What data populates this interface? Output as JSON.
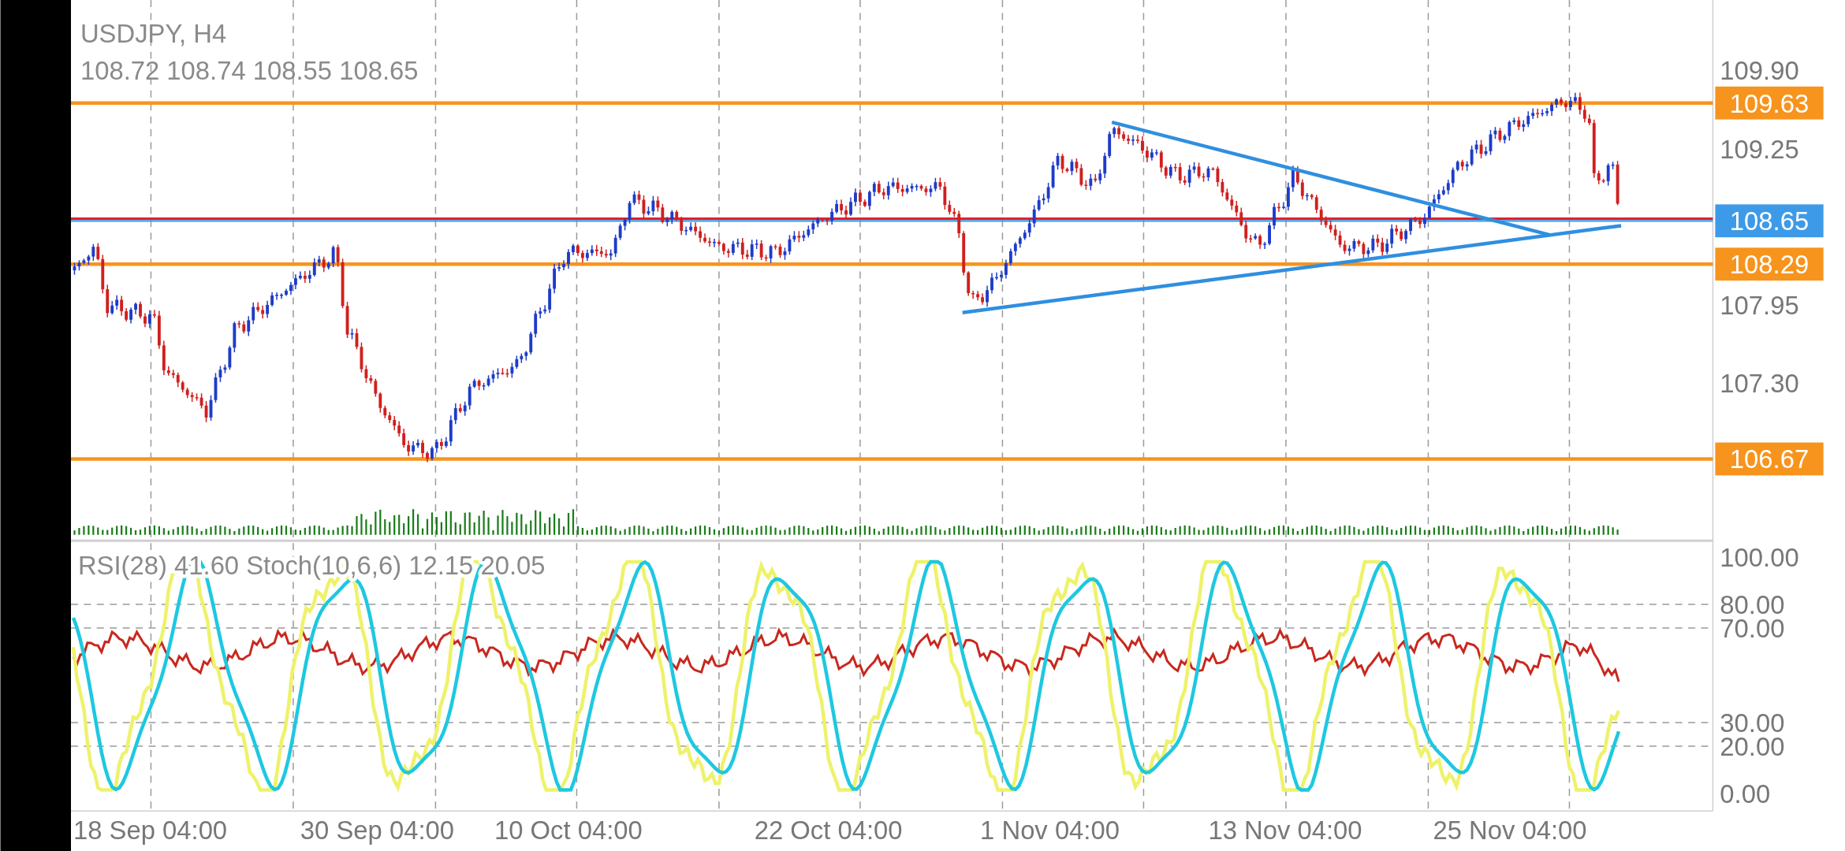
{
  "chart": {
    "symbol": "USDJPY, H4",
    "ohlc": "108.72 108.74 108.55 108.65",
    "price_ticks": [
      "109.90",
      "109.25",
      "107.95",
      "107.30"
    ],
    "levels": [
      {
        "label": "109.63",
        "color": "#f7941d"
      },
      {
        "label": "108.65",
        "color": "#3d9ae8"
      },
      {
        "label": "108.29",
        "color": "#f7941d"
      },
      {
        "label": "106.67",
        "color": "#f7941d"
      }
    ]
  },
  "indicator": {
    "legend": "RSI(28) 41.60 Stoch(10,6,6) 12.15 20.05",
    "ticks": [
      "100.00",
      "80.00",
      "70.00",
      "30.00",
      "20.00",
      "0.00"
    ]
  },
  "time_axis": [
    "18 Sep 04:00",
    "30 Sep 04:00",
    "10 Oct 04:00",
    "22 Oct 04:00",
    "1 Nov 04:00",
    "13 Nov 04:00",
    "25 Nov 04:00"
  ]
}
